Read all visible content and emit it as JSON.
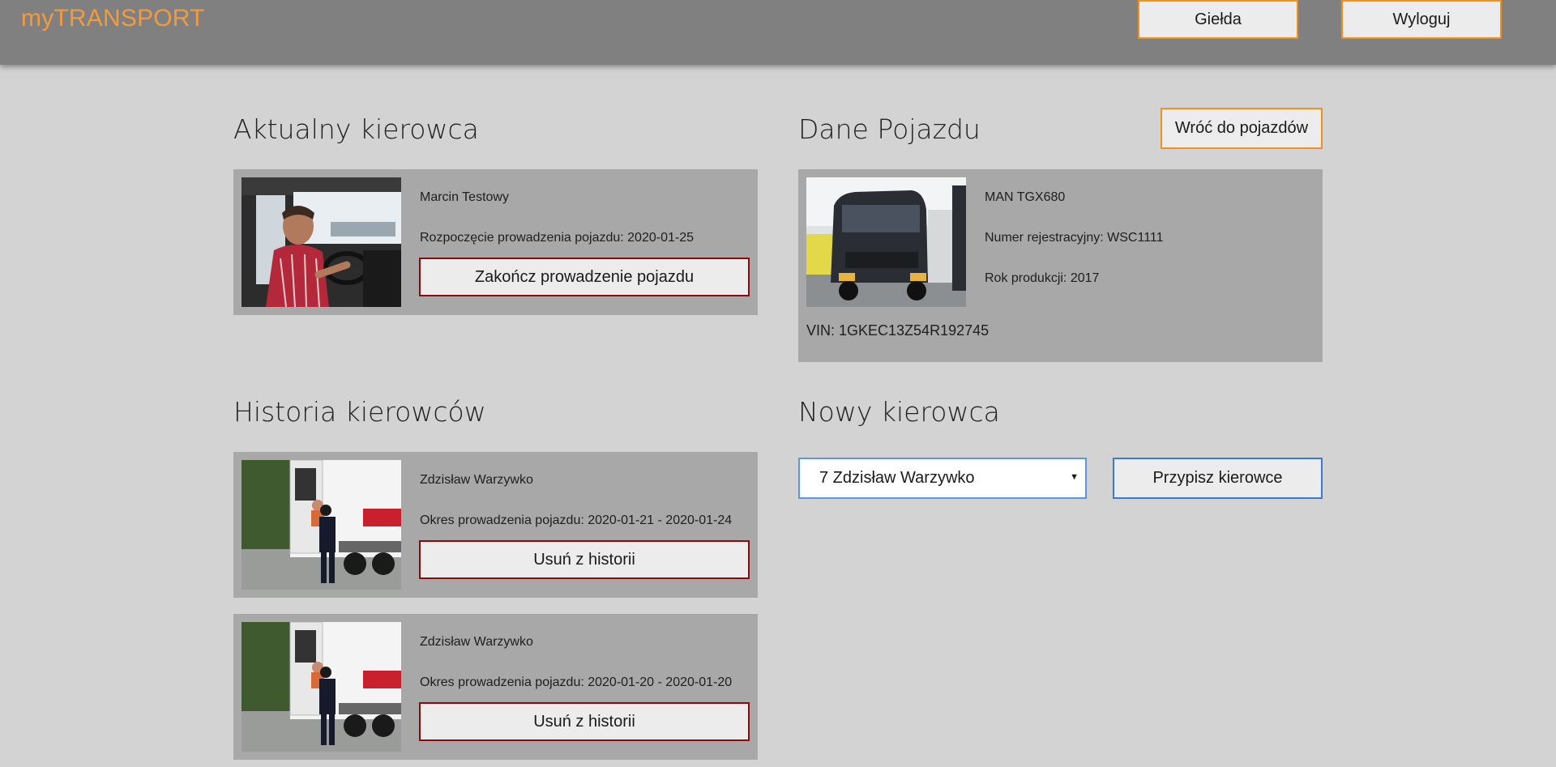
{
  "header": {
    "logo_prefix": "my",
    "logo_suffix": "TRANSPORT",
    "buttons": {
      "gielda": "Giełda",
      "logout": "Wyloguj"
    }
  },
  "current_driver": {
    "heading": "Aktualny kierowca",
    "name": "Marcin Testowy",
    "start": "Rozpoczęcie prowadzenia pojazdu: 2020-01-25",
    "end_button": "Zakończ prowadzenie pojazdu"
  },
  "vehicle": {
    "heading": "Dane Pojazdu",
    "back_button": "Wróć do pojazdów",
    "model": "MAN TGX680",
    "registration": "Numer rejestracyjny: WSC1111",
    "year": "Rok produkcji: 2017",
    "vin": "VIN: 1GKEC13Z54R192745"
  },
  "history": {
    "heading": "Historia kierowców",
    "items": [
      {
        "name": "Zdzisław Warzywko",
        "period": "Okres prowadzenia pojazdu: 2020-01-21 - 2020-01-24",
        "remove": "Usuń z historii"
      },
      {
        "name": "Zdzisław Warzywko",
        "period": "Okres prowadzenia pojazdu: 2020-01-20 - 2020-01-20",
        "remove": "Usuń z historii"
      }
    ]
  },
  "new_driver": {
    "heading": "Nowy kierowca",
    "selected": "7 Zdzisław Warzywko",
    "assign_button": "Przypisz kierowce"
  },
  "icons": [
    "chevron-down-icon"
  ],
  "colors": {
    "accent": "#f0901e",
    "danger": "#8b0a0a",
    "focus": "#3a7ad0",
    "panel": "#a8a8a8",
    "background": "#d3d3d3"
  }
}
